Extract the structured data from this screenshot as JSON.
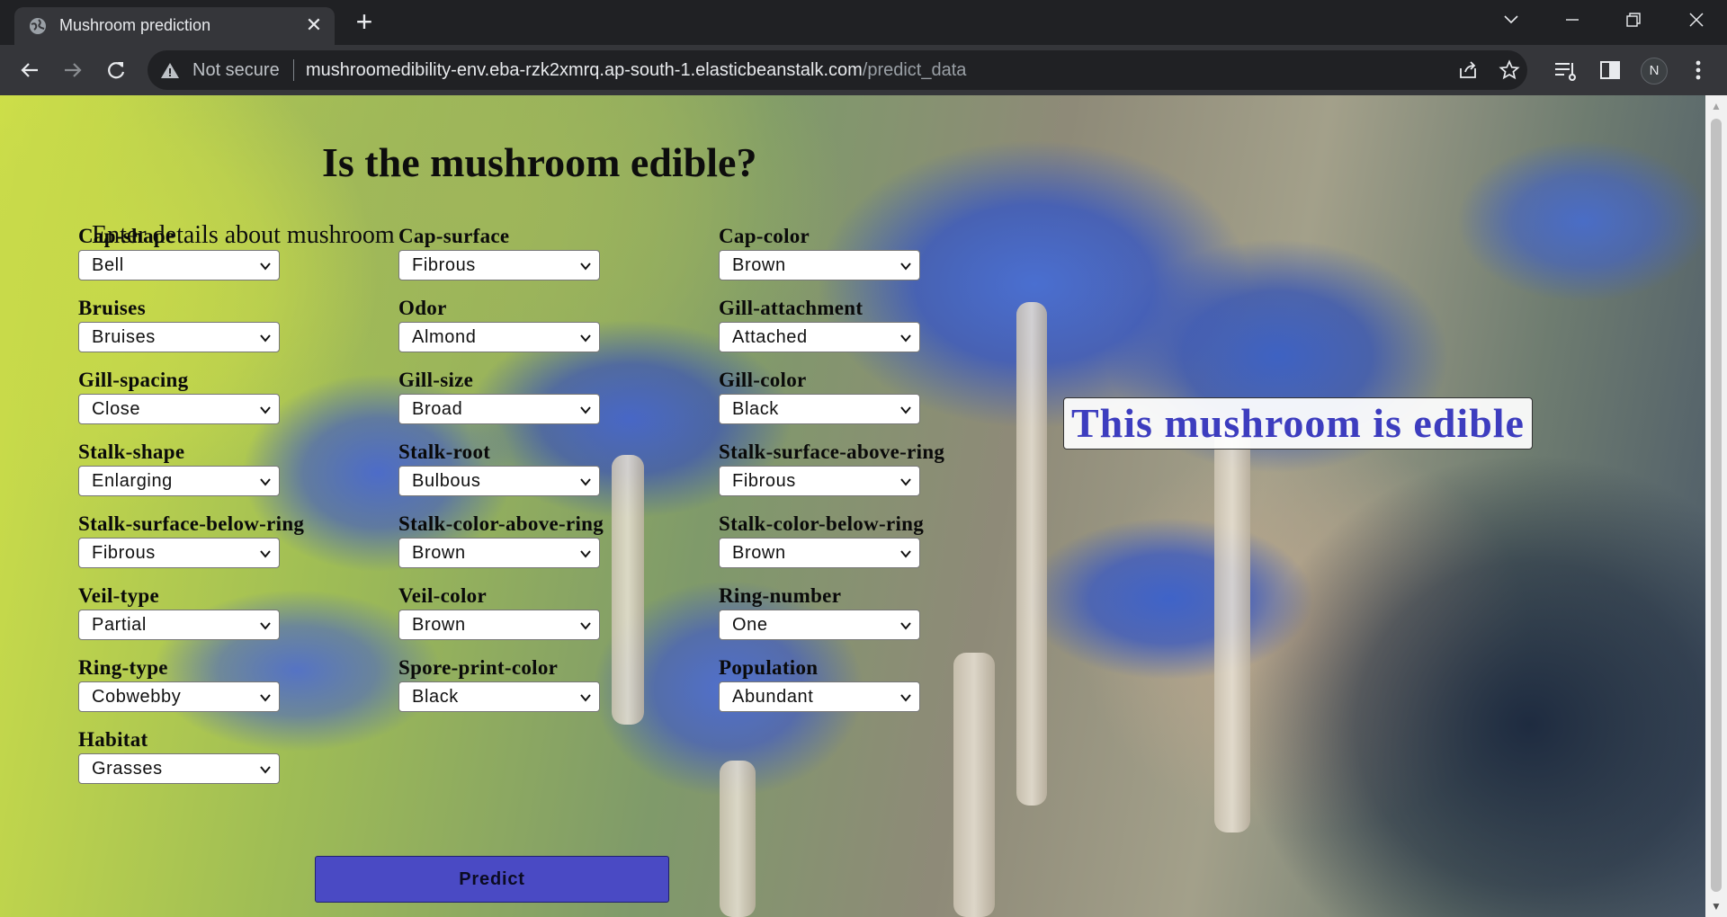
{
  "browser": {
    "tab_title": "Mushroom prediction",
    "security_label": "Not secure",
    "url_host": "mushroomedibility-env.eba-rzk2xmrq.ap-south-1.elasticbeanstalk.com",
    "url_path": "/predict_data",
    "profile_initial": "N"
  },
  "page": {
    "heading": "Is the mushroom edible?",
    "subheading": "Enter details about mushroom",
    "predict_label": "Predict",
    "result_text": "This mushroom is edible"
  },
  "fields": [
    {
      "label": "Cap-shape",
      "value": "Bell"
    },
    {
      "label": "Cap-surface",
      "value": "Fibrous"
    },
    {
      "label": "Cap-color",
      "value": "Brown"
    },
    {
      "label": "Bruises",
      "value": "Bruises"
    },
    {
      "label": "Odor",
      "value": "Almond"
    },
    {
      "label": "Gill-attachment",
      "value": "Attached"
    },
    {
      "label": "Gill-spacing",
      "value": "Close"
    },
    {
      "label": "Gill-size",
      "value": "Broad"
    },
    {
      "label": "Gill-color",
      "value": "Black"
    },
    {
      "label": "Stalk-shape",
      "value": "Enlarging"
    },
    {
      "label": "Stalk-root",
      "value": "Bulbous"
    },
    {
      "label": "Stalk-surface-above-ring",
      "value": "Fibrous"
    },
    {
      "label": "Stalk-surface-below-ring",
      "value": "Fibrous"
    },
    {
      "label": "Stalk-color-above-ring",
      "value": "Brown"
    },
    {
      "label": "Stalk-color-below-ring",
      "value": "Brown"
    },
    {
      "label": "Veil-type",
      "value": "Partial"
    },
    {
      "label": "Veil-color",
      "value": "Brown"
    },
    {
      "label": "Ring-number",
      "value": "One"
    },
    {
      "label": "Ring-type",
      "value": "Cobwebby"
    },
    {
      "label": "Spore-print-color",
      "value": "Black"
    },
    {
      "label": "Population",
      "value": "Abundant"
    },
    {
      "label": "Habitat",
      "value": "Grasses"
    }
  ],
  "icons": {
    "favicon": "globe-icon",
    "close_tab": "close-icon",
    "new_tab": "plus-icon",
    "warning": "warning-icon",
    "share": "share-icon",
    "bookmark": "star-icon",
    "reading_list": "reading-list-icon",
    "side_panel": "side-panel-icon",
    "menu": "kebab-menu-icon"
  },
  "colors": {
    "button_bg": "#4a4ac4",
    "result_text": "#3d3dbf",
    "chrome_dark": "#202124",
    "chrome_toolbar": "#35363a"
  }
}
